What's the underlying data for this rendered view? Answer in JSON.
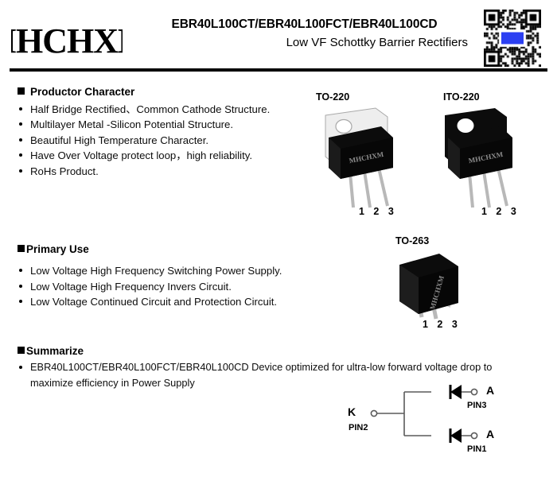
{
  "header": {
    "logo_text": "MHCHXM",
    "part_numbers": "EBR40L100CT/EBR40L100FCT/EBR40L100CD",
    "subtitle": "Low VF Schottky Barrier Rectifiers",
    "qr_icon": "qr-code-icon"
  },
  "sections": {
    "character": {
      "title": "Productor Character",
      "items": [
        "Half Bridge Rectified、Common Cathode Structure.",
        "Multilayer Metal -Silicon Potential Structure.",
        "Beautiful High Temperature Character.",
        "Have Over Voltage protect loop，high  reliability.",
        "RoHs Product."
      ]
    },
    "primary_use": {
      "title": "Primary Use",
      "items": [
        "Low Voltage High Frequency Switching Power Supply.",
        "Low Voltage High Frequency  Invers Circuit.",
        "Low Voltage Continued  Circuit and Protection Circuit."
      ]
    },
    "summarize": {
      "title": "Summarize",
      "items": [
        "EBR40L100CT/EBR40L100FCT/EBR40L100CD Device optimized for ultra-low forward voltage drop to maximize efficiency in Power Supply"
      ]
    }
  },
  "packages": [
    {
      "name": "TO-220",
      "pins": "1 2 3"
    },
    {
      "name": "ITO-220",
      "pins": "1 2 3"
    },
    {
      "name": "TO-263",
      "pins": "1 2 3"
    }
  ],
  "package_marking": "MHCHXM",
  "circuit": {
    "cathode_label": "K",
    "cathode_pin": "PIN2",
    "anode_top_label": "A",
    "anode_top_pin": "PIN3",
    "anode_bottom_label": "A",
    "anode_bottom_pin": "PIN1"
  },
  "colors": {
    "text": "#000000",
    "rule": "#000000",
    "package_body": "#0a0a0a",
    "package_tab": "#d2d2d2",
    "qr_logo": "#2b3ff2"
  }
}
